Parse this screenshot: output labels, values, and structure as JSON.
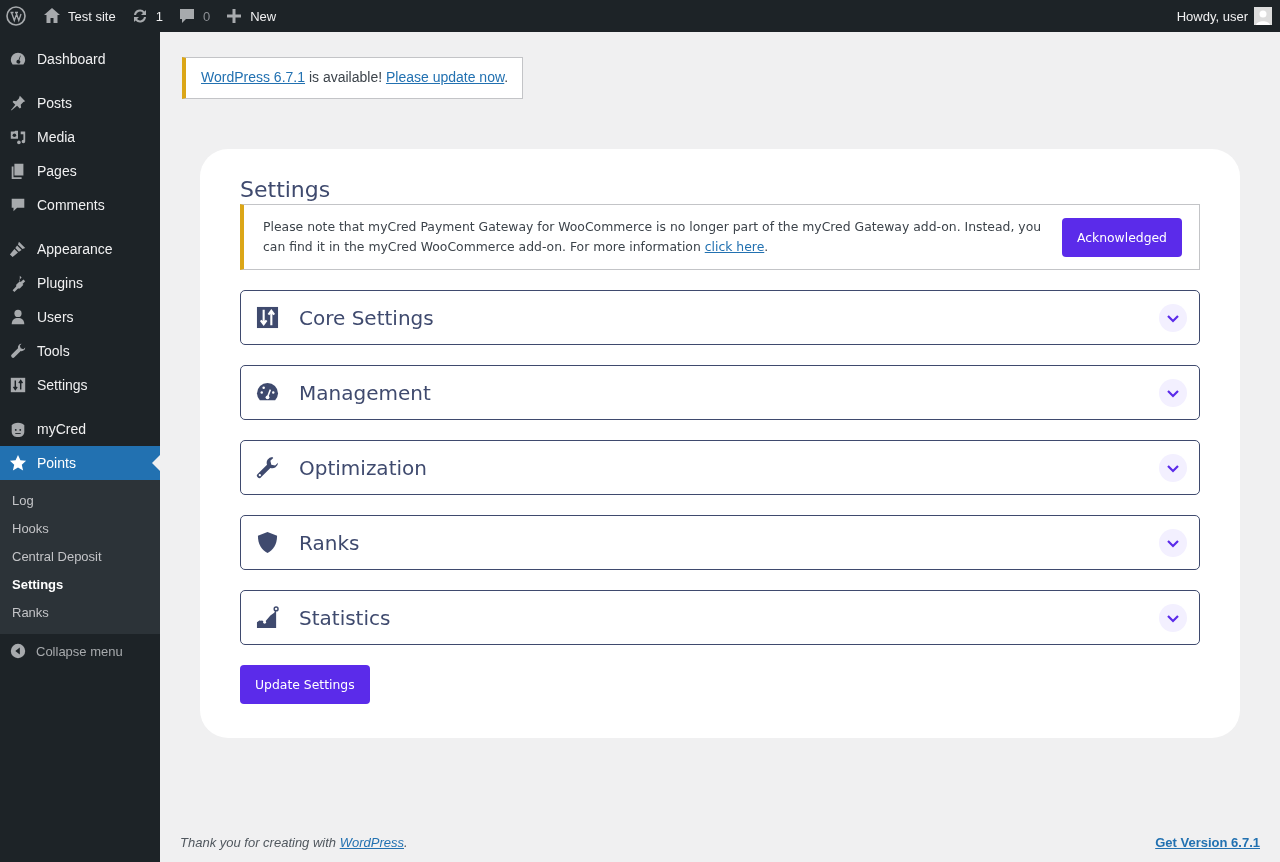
{
  "admin_bar": {
    "site": "Test site",
    "updates": "1",
    "comments": "0",
    "new": "New",
    "greeting": "Howdy, user"
  },
  "sidebar": {
    "groups": [
      [
        {
          "label": "Dashboard",
          "selected": false
        }
      ],
      [
        {
          "label": "Posts",
          "selected": false
        },
        {
          "label": "Media",
          "selected": false
        },
        {
          "label": "Pages",
          "selected": false
        },
        {
          "label": "Comments",
          "selected": false
        }
      ],
      [
        {
          "label": "Appearance",
          "selected": false
        },
        {
          "label": "Plugins",
          "selected": false
        },
        {
          "label": "Users",
          "selected": false
        },
        {
          "label": "Tools",
          "selected": false
        },
        {
          "label": "Settings",
          "selected": false
        }
      ],
      [
        {
          "label": "myCred",
          "selected": false
        },
        {
          "label": "Points",
          "selected": true,
          "children": [
            {
              "label": "Log",
              "selected": false
            },
            {
              "label": "Hooks",
              "selected": false
            },
            {
              "label": "Central Deposit",
              "selected": false
            },
            {
              "label": "Settings",
              "selected": true
            },
            {
              "label": "Ranks",
              "selected": false
            }
          ]
        }
      ]
    ],
    "collapse": "Collapse menu"
  },
  "update_notice": {
    "link": "WordPress 6.7.1",
    "text": " is available! ",
    "action": "Please update now",
    "end": "."
  },
  "settings": {
    "title": "Settings",
    "notice": {
      "text": "Please note that myCred Payment Gateway for WooCommerce is no longer part of the myCred Gateway add-on. Instead, you can find it in the myCred WooCommerce add-on. For more information ",
      "link": "click here",
      "end": ".",
      "button": "Acknowledged"
    },
    "sections": [
      {
        "title": "Core Settings",
        "expanded": false
      },
      {
        "title": "Management",
        "expanded": false
      },
      {
        "title": "Optimization",
        "expanded": false
      },
      {
        "title": "Ranks",
        "expanded": false
      },
      {
        "title": "Statistics",
        "expanded": false
      }
    ],
    "submit": "Update Settings"
  },
  "footer": {
    "text": "Thank you for creating with ",
    "link": "WordPress",
    "end": ".",
    "version": "Get Version 6.7.1"
  }
}
